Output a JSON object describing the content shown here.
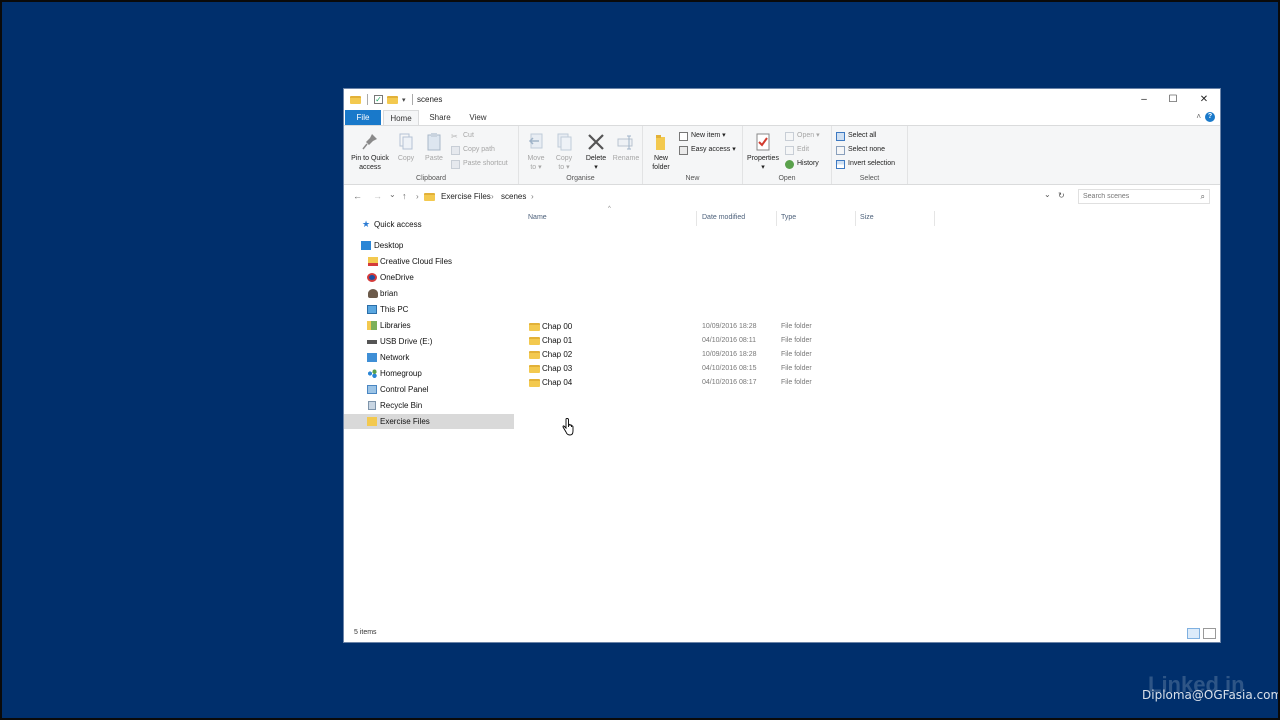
{
  "window": {
    "title": "scenes",
    "controls": {
      "minimize": "–",
      "maximize": "☐",
      "close": "✕"
    }
  },
  "tabs": {
    "file": "File",
    "home": "Home",
    "share": "Share",
    "view": "View",
    "help": "?"
  },
  "ribbon": {
    "clipboard": {
      "label": "Clipboard",
      "pin_line1": "Pin to Quick",
      "pin_line2": "access",
      "copy": "Copy",
      "paste": "Paste",
      "cut": "Cut",
      "copy_path": "Copy path",
      "paste_shortcut": "Paste shortcut"
    },
    "organise": {
      "label": "Organise",
      "move_line1": "Move",
      "move_line2": "to ▾",
      "copy_line1": "Copy",
      "copy_line2": "to ▾",
      "delete_line1": "Delete",
      "delete_line2": "▾",
      "rename": "Rename"
    },
    "new": {
      "label": "New",
      "folder_line1": "New",
      "folder_line2": "folder",
      "new_item": "New item ▾",
      "easy_access": "Easy access ▾"
    },
    "open": {
      "label": "Open",
      "properties_line1": "Properties",
      "properties_line2": "▾",
      "open": "Open ▾",
      "edit": "Edit",
      "history": "History"
    },
    "select": {
      "label": "Select",
      "select_all": "Select all",
      "select_none": "Select none",
      "invert_selection": "Invert selection"
    }
  },
  "address": {
    "back": "←",
    "forward": "→",
    "recent": "⌄",
    "up": "↑",
    "sep": "›",
    "crumbs": [
      "Exercise Files",
      "scenes"
    ],
    "dropdown": "⌄",
    "refresh": "↻",
    "search_placeholder": "Search scenes",
    "search_glyph": "⌕"
  },
  "nav": {
    "quick_access": "Quick access",
    "desktop": "Desktop",
    "items": [
      "Creative Cloud Files",
      "OneDrive",
      "brian",
      "This PC",
      "Libraries",
      "USB Drive (E:)",
      "Network",
      "Homegroup",
      "Control Panel",
      "Recycle Bin",
      "Exercise Files"
    ]
  },
  "columns": {
    "name": "Name",
    "date": "Date modified",
    "type": "Type",
    "size": "Size",
    "sort": "^"
  },
  "rows": [
    {
      "name": "Chap 00",
      "date": "10/09/2016 18:28",
      "type": "File folder"
    },
    {
      "name": "Chap 01",
      "date": "04/10/2016 08:11",
      "type": "File folder"
    },
    {
      "name": "Chap 02",
      "date": "10/09/2016 18:28",
      "type": "File folder"
    },
    {
      "name": "Chap 03",
      "date": "04/10/2016 08:15",
      "type": "File folder"
    },
    {
      "name": "Chap 04",
      "date": "04/10/2016 08:17",
      "type": "File folder"
    }
  ],
  "status": {
    "count": "5 items"
  },
  "overlay": {
    "watermark": "Diploma@OGFasia.com",
    "logo": "Linked in"
  },
  "colors": {
    "desktop": "#002f6c",
    "accent": "#1979ca",
    "folder": "#f3c94f",
    "selected": "#d9d9d9"
  }
}
